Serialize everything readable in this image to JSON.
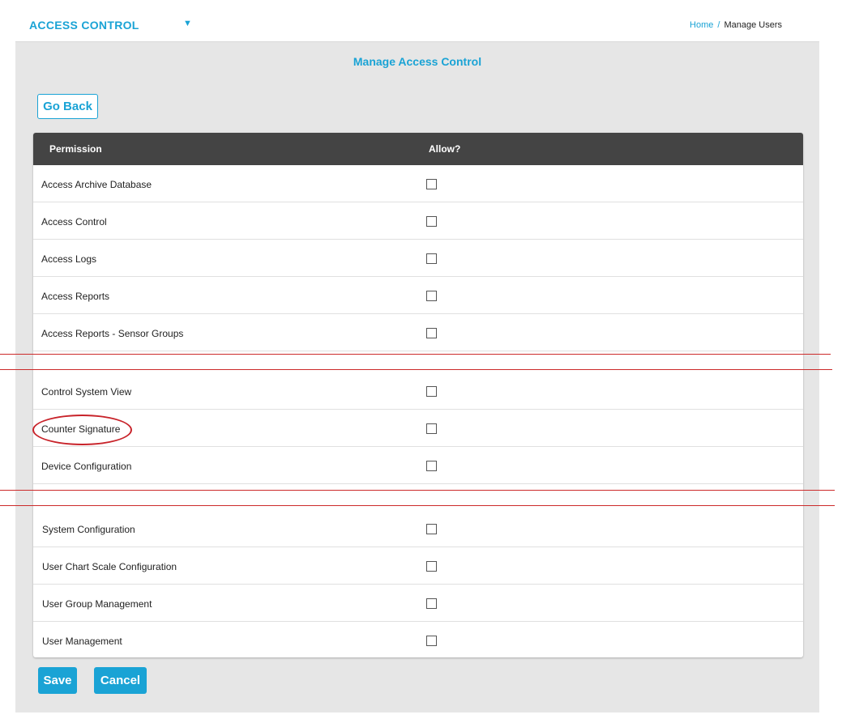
{
  "header": {
    "module_title": "ACCESS CONTROL",
    "breadcrumb": {
      "home": "Home",
      "separator": "/",
      "current": "Manage Users"
    }
  },
  "page": {
    "title": "Manage Access Control",
    "go_back_label": "Go Back"
  },
  "table": {
    "headers": {
      "permission": "Permission",
      "allow": "Allow?"
    },
    "rows": [
      {
        "label": "Access Archive Database",
        "allowed": false
      },
      {
        "label": "Access Control",
        "allowed": false
      },
      {
        "label": "Access Logs",
        "allowed": false
      },
      {
        "label": "Access Reports",
        "allowed": false
      },
      {
        "label": "Access Reports - Sensor Groups",
        "allowed": false
      },
      {
        "label": "Control System View",
        "allowed": false
      },
      {
        "label": "Counter Signature",
        "allowed": false
      },
      {
        "label": "Device Configuration",
        "allowed": false
      },
      {
        "label": "System Configuration",
        "allowed": false
      },
      {
        "label": "User Chart Scale Configuration",
        "allowed": false
      },
      {
        "label": "User Group Management",
        "allowed": false
      },
      {
        "label": "User Management",
        "allowed": false
      }
    ]
  },
  "actions": {
    "save_label": "Save",
    "cancel_label": "Cancel"
  },
  "colors": {
    "accent": "#1aa3d5",
    "header_bg": "#444444",
    "annotation_red": "#c8232a"
  },
  "icons": {
    "module_dropdown": "caret-down-icon",
    "checkbox": "empty-checkbox-icon"
  }
}
